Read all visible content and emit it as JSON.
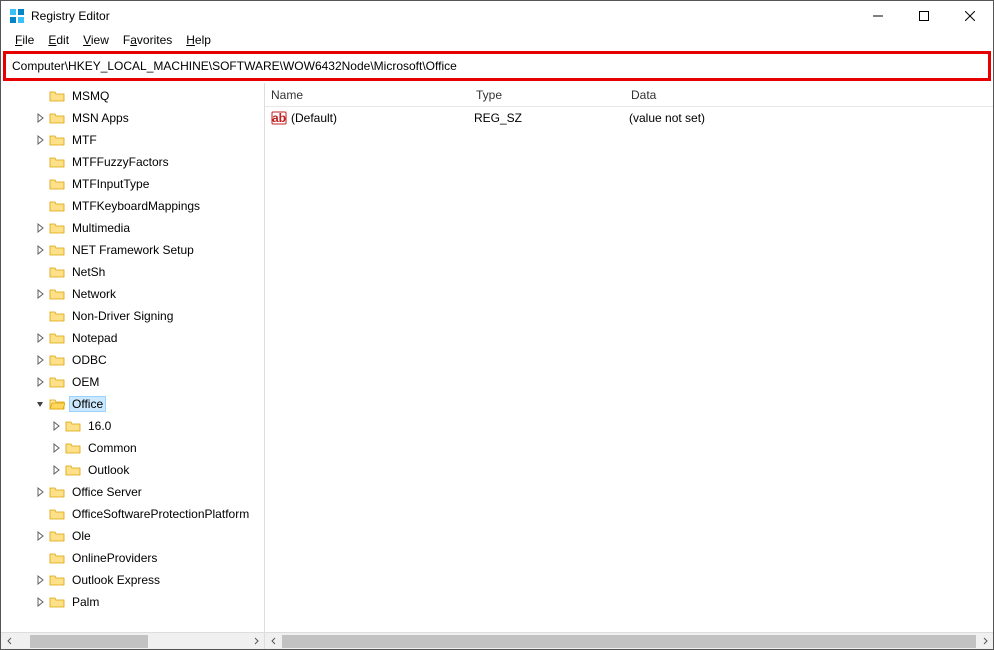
{
  "window": {
    "title": "Registry Editor"
  },
  "menu": {
    "file": "File",
    "edit": "Edit",
    "view": "View",
    "favorites": "Favorites",
    "help": "Help"
  },
  "address": "Computer\\HKEY_LOCAL_MACHINE\\SOFTWARE\\WOW6432Node\\Microsoft\\Office",
  "columns": {
    "name": "Name",
    "type": "Type",
    "data": "Data"
  },
  "values": [
    {
      "name": "(Default)",
      "type": "REG_SZ",
      "data": "(value not set)"
    }
  ],
  "tree": [
    {
      "level": 2,
      "exp": "none",
      "label": "MSMQ"
    },
    {
      "level": 2,
      "exp": "closed",
      "label": "MSN Apps"
    },
    {
      "level": 2,
      "exp": "closed",
      "label": "MTF"
    },
    {
      "level": 2,
      "exp": "none",
      "label": "MTFFuzzyFactors"
    },
    {
      "level": 2,
      "exp": "none",
      "label": "MTFInputType"
    },
    {
      "level": 2,
      "exp": "none",
      "label": "MTFKeyboardMappings"
    },
    {
      "level": 2,
      "exp": "closed",
      "label": "Multimedia"
    },
    {
      "level": 2,
      "exp": "closed",
      "label": "NET Framework Setup"
    },
    {
      "level": 2,
      "exp": "none",
      "label": "NetSh"
    },
    {
      "level": 2,
      "exp": "closed",
      "label": "Network"
    },
    {
      "level": 2,
      "exp": "none",
      "label": "Non-Driver Signing"
    },
    {
      "level": 2,
      "exp": "closed",
      "label": "Notepad"
    },
    {
      "level": 2,
      "exp": "closed",
      "label": "ODBC"
    },
    {
      "level": 2,
      "exp": "closed",
      "label": "OEM"
    },
    {
      "level": 2,
      "exp": "open",
      "label": "Office",
      "selected": true
    },
    {
      "level": 3,
      "exp": "closed",
      "label": "16.0"
    },
    {
      "level": 3,
      "exp": "closed",
      "label": "Common"
    },
    {
      "level": 3,
      "exp": "closed",
      "label": "Outlook"
    },
    {
      "level": 2,
      "exp": "closed",
      "label": "Office Server"
    },
    {
      "level": 2,
      "exp": "none",
      "label": "OfficeSoftwareProtectionPlatform"
    },
    {
      "level": 2,
      "exp": "closed",
      "label": "Ole"
    },
    {
      "level": 2,
      "exp": "none",
      "label": "OnlineProviders"
    },
    {
      "level": 2,
      "exp": "closed",
      "label": "Outlook Express"
    },
    {
      "level": 2,
      "exp": "closed",
      "label": "Palm"
    }
  ]
}
